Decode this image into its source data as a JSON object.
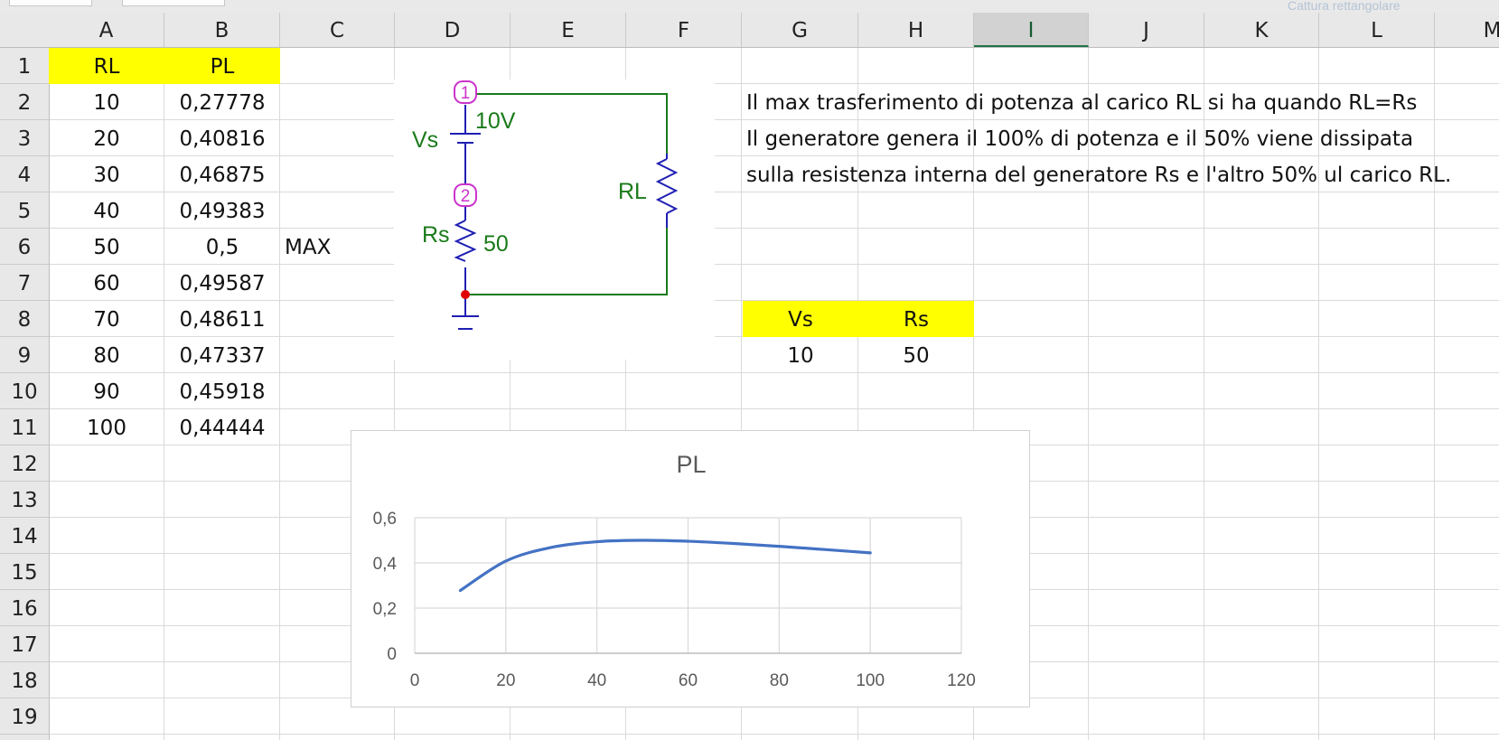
{
  "window": {
    "snip_button_label": "Cattura rettangolare"
  },
  "columns": [
    "A",
    "B",
    "C",
    "D",
    "E",
    "F",
    "G",
    "H",
    "I",
    "J",
    "K",
    "L",
    "M"
  ],
  "selected_column": "I",
  "rows": [
    "1",
    "2",
    "3",
    "4",
    "5",
    "6",
    "7",
    "8",
    "9",
    "10",
    "11",
    "12",
    "13",
    "14",
    "15",
    "16",
    "17",
    "18",
    "19"
  ],
  "table": {
    "headers": [
      "RL",
      "PL"
    ],
    "rows": [
      [
        "10",
        "0,27778"
      ],
      [
        "20",
        "0,40816"
      ],
      [
        "30",
        "0,46875"
      ],
      [
        "40",
        "0,49383"
      ],
      [
        "50",
        "0,5"
      ],
      [
        "60",
        "0,49587"
      ],
      [
        "70",
        "0,48611"
      ],
      [
        "80",
        "0,47337"
      ],
      [
        "90",
        "0,45918"
      ],
      [
        "100",
        "0,44444"
      ]
    ],
    "max_label": "MAX"
  },
  "params": {
    "headers": [
      "Vs",
      "Rs"
    ],
    "values": [
      "10",
      "50"
    ]
  },
  "notes": [
    "Il max trasferimento di potenza al carico RL si ha quando RL=Rs",
    "Il generatore genera il 100% di potenza e il 50% viene dissipata",
    "sulla resistenza interna del generatore Rs e l'altro 50% ul carico RL."
  ],
  "circuit": {
    "node1": "1",
    "node2": "2",
    "source_label": "Vs",
    "source_value": "10V",
    "rs_label": "Rs",
    "rs_value": "50",
    "load_label": "RL",
    "colors": {
      "wire": "#1a7a1a",
      "component": "#1f1fb4",
      "node": "#cc33cc",
      "label": "#1a7a1a",
      "junction": "#e00000"
    }
  },
  "colors": {
    "highlight": "#ffff00",
    "series": "#4472c4",
    "selected_header": "#217346"
  },
  "chart_data": {
    "type": "scatter",
    "title": "PL",
    "x": [
      10,
      20,
      30,
      40,
      50,
      60,
      70,
      80,
      90,
      100
    ],
    "series": [
      {
        "name": "PL",
        "values": [
          0.27778,
          0.40816,
          0.46875,
          0.49383,
          0.5,
          0.49587,
          0.48611,
          0.47337,
          0.45918,
          0.44444
        ]
      }
    ],
    "xlim": [
      0,
      120
    ],
    "ylim": [
      0,
      0.6
    ],
    "x_ticks": [
      0,
      20,
      40,
      60,
      80,
      100,
      120
    ],
    "x_tick_labels": [
      "0",
      "20",
      "40",
      "60",
      "80",
      "100",
      "120"
    ],
    "y_ticks": [
      0,
      0.2,
      0.4,
      0.6
    ],
    "y_tick_labels": [
      "0",
      "0,2",
      "0,4",
      "0,6"
    ],
    "smooth_line": true,
    "grid": true,
    "legend": "none"
  }
}
